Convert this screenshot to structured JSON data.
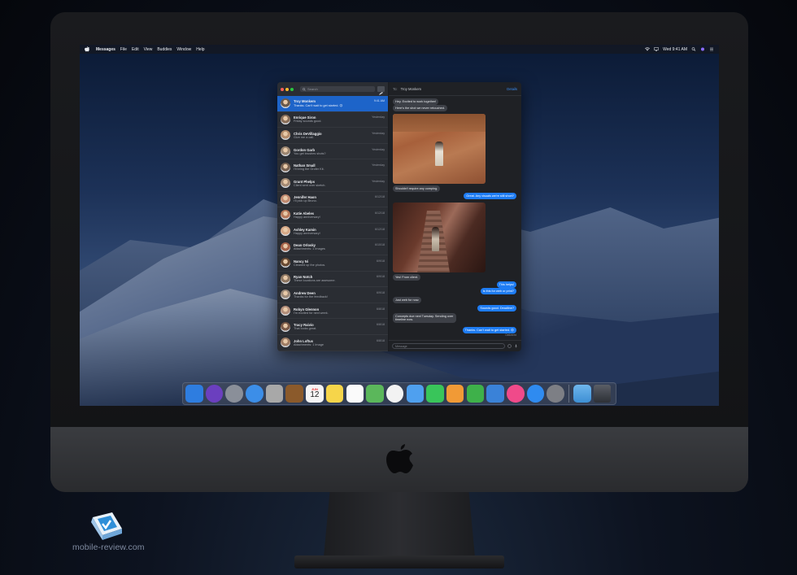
{
  "menubar": {
    "app_name": "Messages",
    "menus": [
      "File",
      "Edit",
      "View",
      "Buddies",
      "Window",
      "Help"
    ],
    "clock": "Wed 9:41 AM"
  },
  "sidebar": {
    "search_placeholder": "Search",
    "conversations": [
      {
        "name": "Troy Monkem",
        "date": "9:41 AM",
        "preview": "Thanks. Can't wait to get started. 😊",
        "selected": true,
        "color": "#6b5a4c"
      },
      {
        "name": "Enrique Siron",
        "date": "Yesterday",
        "preview": "Friday sounds good.",
        "selected": false,
        "color": "#8a6f5a"
      },
      {
        "name": "Chris DeVillaggio",
        "date": "Yesterday",
        "preview": "Give me a call.",
        "selected": false,
        "color": "#b58d6d"
      },
      {
        "name": "Gordon Garb",
        "date": "Yesterday",
        "preview": "You get brushes shots?",
        "selected": false,
        "color": "#9c8671"
      },
      {
        "name": "Nathan Small",
        "date": "Yesterday",
        "preview": "I'll bring the Grofer Kit.",
        "selected": false,
        "color": "#7a6352"
      },
      {
        "name": "Grant Phelps",
        "date": "Yesterday",
        "preview": "Client sent over sketch.",
        "selected": false,
        "color": "#a48a74"
      },
      {
        "name": "Jennifer Haon",
        "date": "6/12/18",
        "preview": "I'll pick up Bruno.",
        "selected": false,
        "color": "#c08a70"
      },
      {
        "name": "Katie Abeles",
        "date": "6/12/18",
        "preview": "Happy anniversary!",
        "selected": false,
        "color": "#b87a5c"
      },
      {
        "name": "Ashley Kamin",
        "date": "6/12/18",
        "preview": "Happy anniversary!",
        "selected": false,
        "color": "#d7a988"
      },
      {
        "name": "Dean Orlosky",
        "date": "6/10/18",
        "preview": "Attachments: 1 Images",
        "selected": false,
        "color": "#a5634a"
      },
      {
        "name": "Nancy Ni",
        "date": "6/9/18",
        "preview": "Cleaned up the photos.",
        "selected": false,
        "color": "#6a4b34"
      },
      {
        "name": "Ryan Notch",
        "date": "6/9/18",
        "preview": "These locations are awesome.",
        "selected": false,
        "color": "#8e7762"
      },
      {
        "name": "Andrew Deen",
        "date": "6/9/18",
        "preview": "Thanks for the feedback!",
        "selected": false,
        "color": "#9d8a7a"
      },
      {
        "name": "Robyn Glennon",
        "date": "6/8/18",
        "preview": "I'm excited for next week.",
        "selected": false,
        "color": "#b48f7b"
      },
      {
        "name": "Tracy Raivio",
        "date": "6/8/18",
        "preview": "That looks great.",
        "selected": false,
        "color": "#7b5a48"
      },
      {
        "name": "John Loftus",
        "date": "6/8/18",
        "preview": "Attachments: 1 Image",
        "selected": false,
        "color": "#a07e66"
      }
    ]
  },
  "chat": {
    "to_label": "To:",
    "recipient": "Troy Monkem",
    "details_label": "Details",
    "messages": {
      "m1": "Hey. Excited to work together!",
      "m2": "Here's the shot we never retouched.",
      "m3": "Shouldn't require any comping.",
      "m4": "Great. Any visuals we're still short?",
      "m5": "Yes! From client.",
      "m6": "This helps!",
      "m7": "Is this for web or print?",
      "m8": "Just web for now.",
      "m9": "Sounds good. Deadline?",
      "m10": "Concepts due next Tuesday. Sending over timeline now.",
      "m11": "Thanks. Can't wait to get started. 😊"
    },
    "delivered": "Delivered",
    "input_placeholder": "Message"
  },
  "dock": {
    "apps": [
      {
        "name": "Finder",
        "color": "#2e7de0"
      },
      {
        "name": "Siri",
        "color": "#6b3fbf"
      },
      {
        "name": "Launchpad",
        "color": "#8a8f99"
      },
      {
        "name": "Safari",
        "color": "#3c8ee8"
      },
      {
        "name": "Photo Booth",
        "color": "#a8a8a8"
      },
      {
        "name": "Notes Book",
        "color": "#8b5a2b"
      },
      {
        "name": "Calendar",
        "color": "#f5f5f5"
      },
      {
        "name": "Notes",
        "color": "#f6d54a"
      },
      {
        "name": "Reminders",
        "color": "#fafafa"
      },
      {
        "name": "Maps",
        "color": "#5bb75b"
      },
      {
        "name": "Photos",
        "color": "#f2f2f2"
      },
      {
        "name": "Messages",
        "color": "#4fa0ef"
      },
      {
        "name": "FaceTime",
        "color": "#39c55a"
      },
      {
        "name": "Pages",
        "color": "#f19a36"
      },
      {
        "name": "Numbers",
        "color": "#3eb14a"
      },
      {
        "name": "Keynote",
        "color": "#3a82d8"
      },
      {
        "name": "iTunes",
        "color": "#f04a8a"
      },
      {
        "name": "App Store",
        "color": "#2f8bf0"
      },
      {
        "name": "System Preferences",
        "color": "#7d7f85"
      }
    ],
    "calendar_day": "12",
    "calendar_month": "JUN"
  },
  "watermark": {
    "text": "mobile-review.com"
  }
}
